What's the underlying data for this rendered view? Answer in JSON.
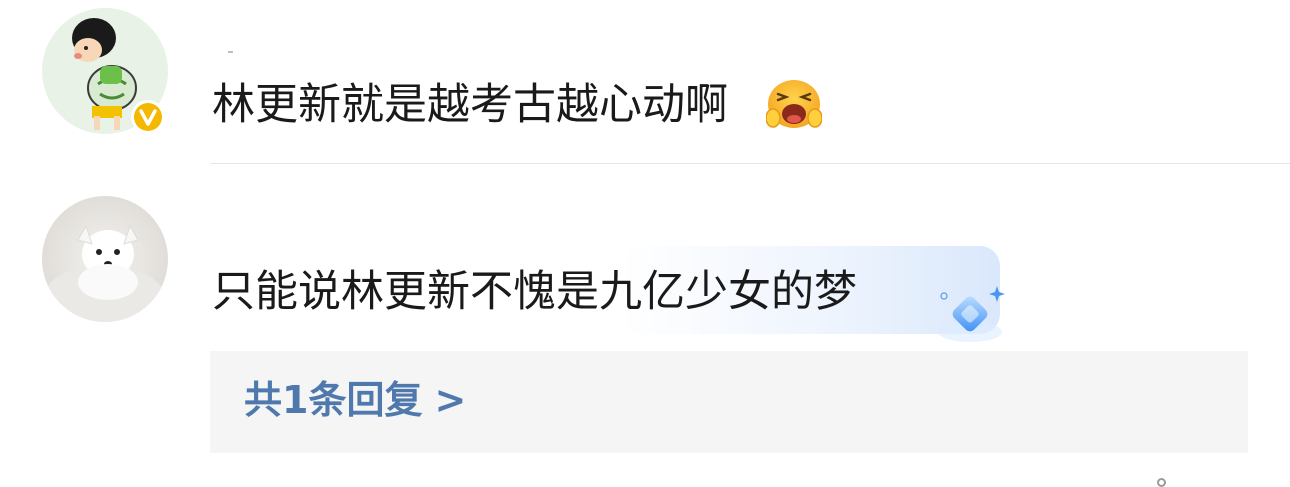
{
  "comments": [
    {
      "avatar": "cartoon-boy-avatar",
      "verified": true,
      "text": "林更新就是越考古越心动啊",
      "emoji": "laughing-crying-face"
    },
    {
      "avatar": "white-puppy-avatar",
      "verified": false,
      "text": "只能说林更新不愧是九亿少女的梦",
      "sticker": "blue-diamond-sparkle"
    }
  ],
  "replies": {
    "label": "共1条回复",
    "chevron": ">"
  },
  "colors": {
    "reply_link": "#4f79ad",
    "verified_badge": "#f5b800",
    "text": "#1a1a1a"
  }
}
